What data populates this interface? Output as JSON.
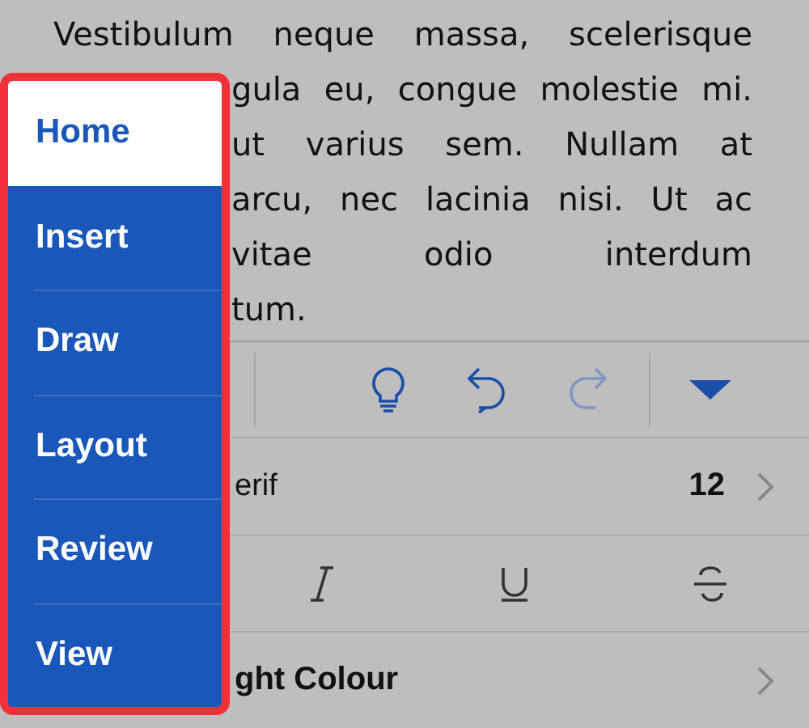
{
  "document": {
    "lines": [
      {
        "text": "Vestibulum neque massa, scelerisque",
        "kind": "full"
      },
      {
        "text": "gula eu, congue molestie mi.",
        "kind": "justified"
      },
      {
        "text": "ut varius sem. Nullam at",
        "kind": "justified"
      },
      {
        "text": "arcu, nec lacinia nisi. Ut ac",
        "kind": "justified"
      },
      {
        "text": "vitae odio interdum",
        "kind": "justified"
      },
      {
        "text": "tum.",
        "kind": "last"
      }
    ]
  },
  "toolbar": {
    "redo_disabled": true
  },
  "font": {
    "name": "erif",
    "size": "12"
  },
  "format": [
    {
      "kind": "italic"
    },
    {
      "kind": "underline"
    },
    {
      "kind": "strikethrough"
    }
  ],
  "highlight": {
    "label": "ght Colour"
  },
  "menu": {
    "items": [
      {
        "label": "Home",
        "selected": true
      },
      {
        "label": "Insert",
        "selected": false
      },
      {
        "label": "Draw",
        "selected": false
      },
      {
        "label": "Layout",
        "selected": false
      },
      {
        "label": "Review",
        "selected": false
      },
      {
        "label": "View",
        "selected": false
      }
    ]
  }
}
